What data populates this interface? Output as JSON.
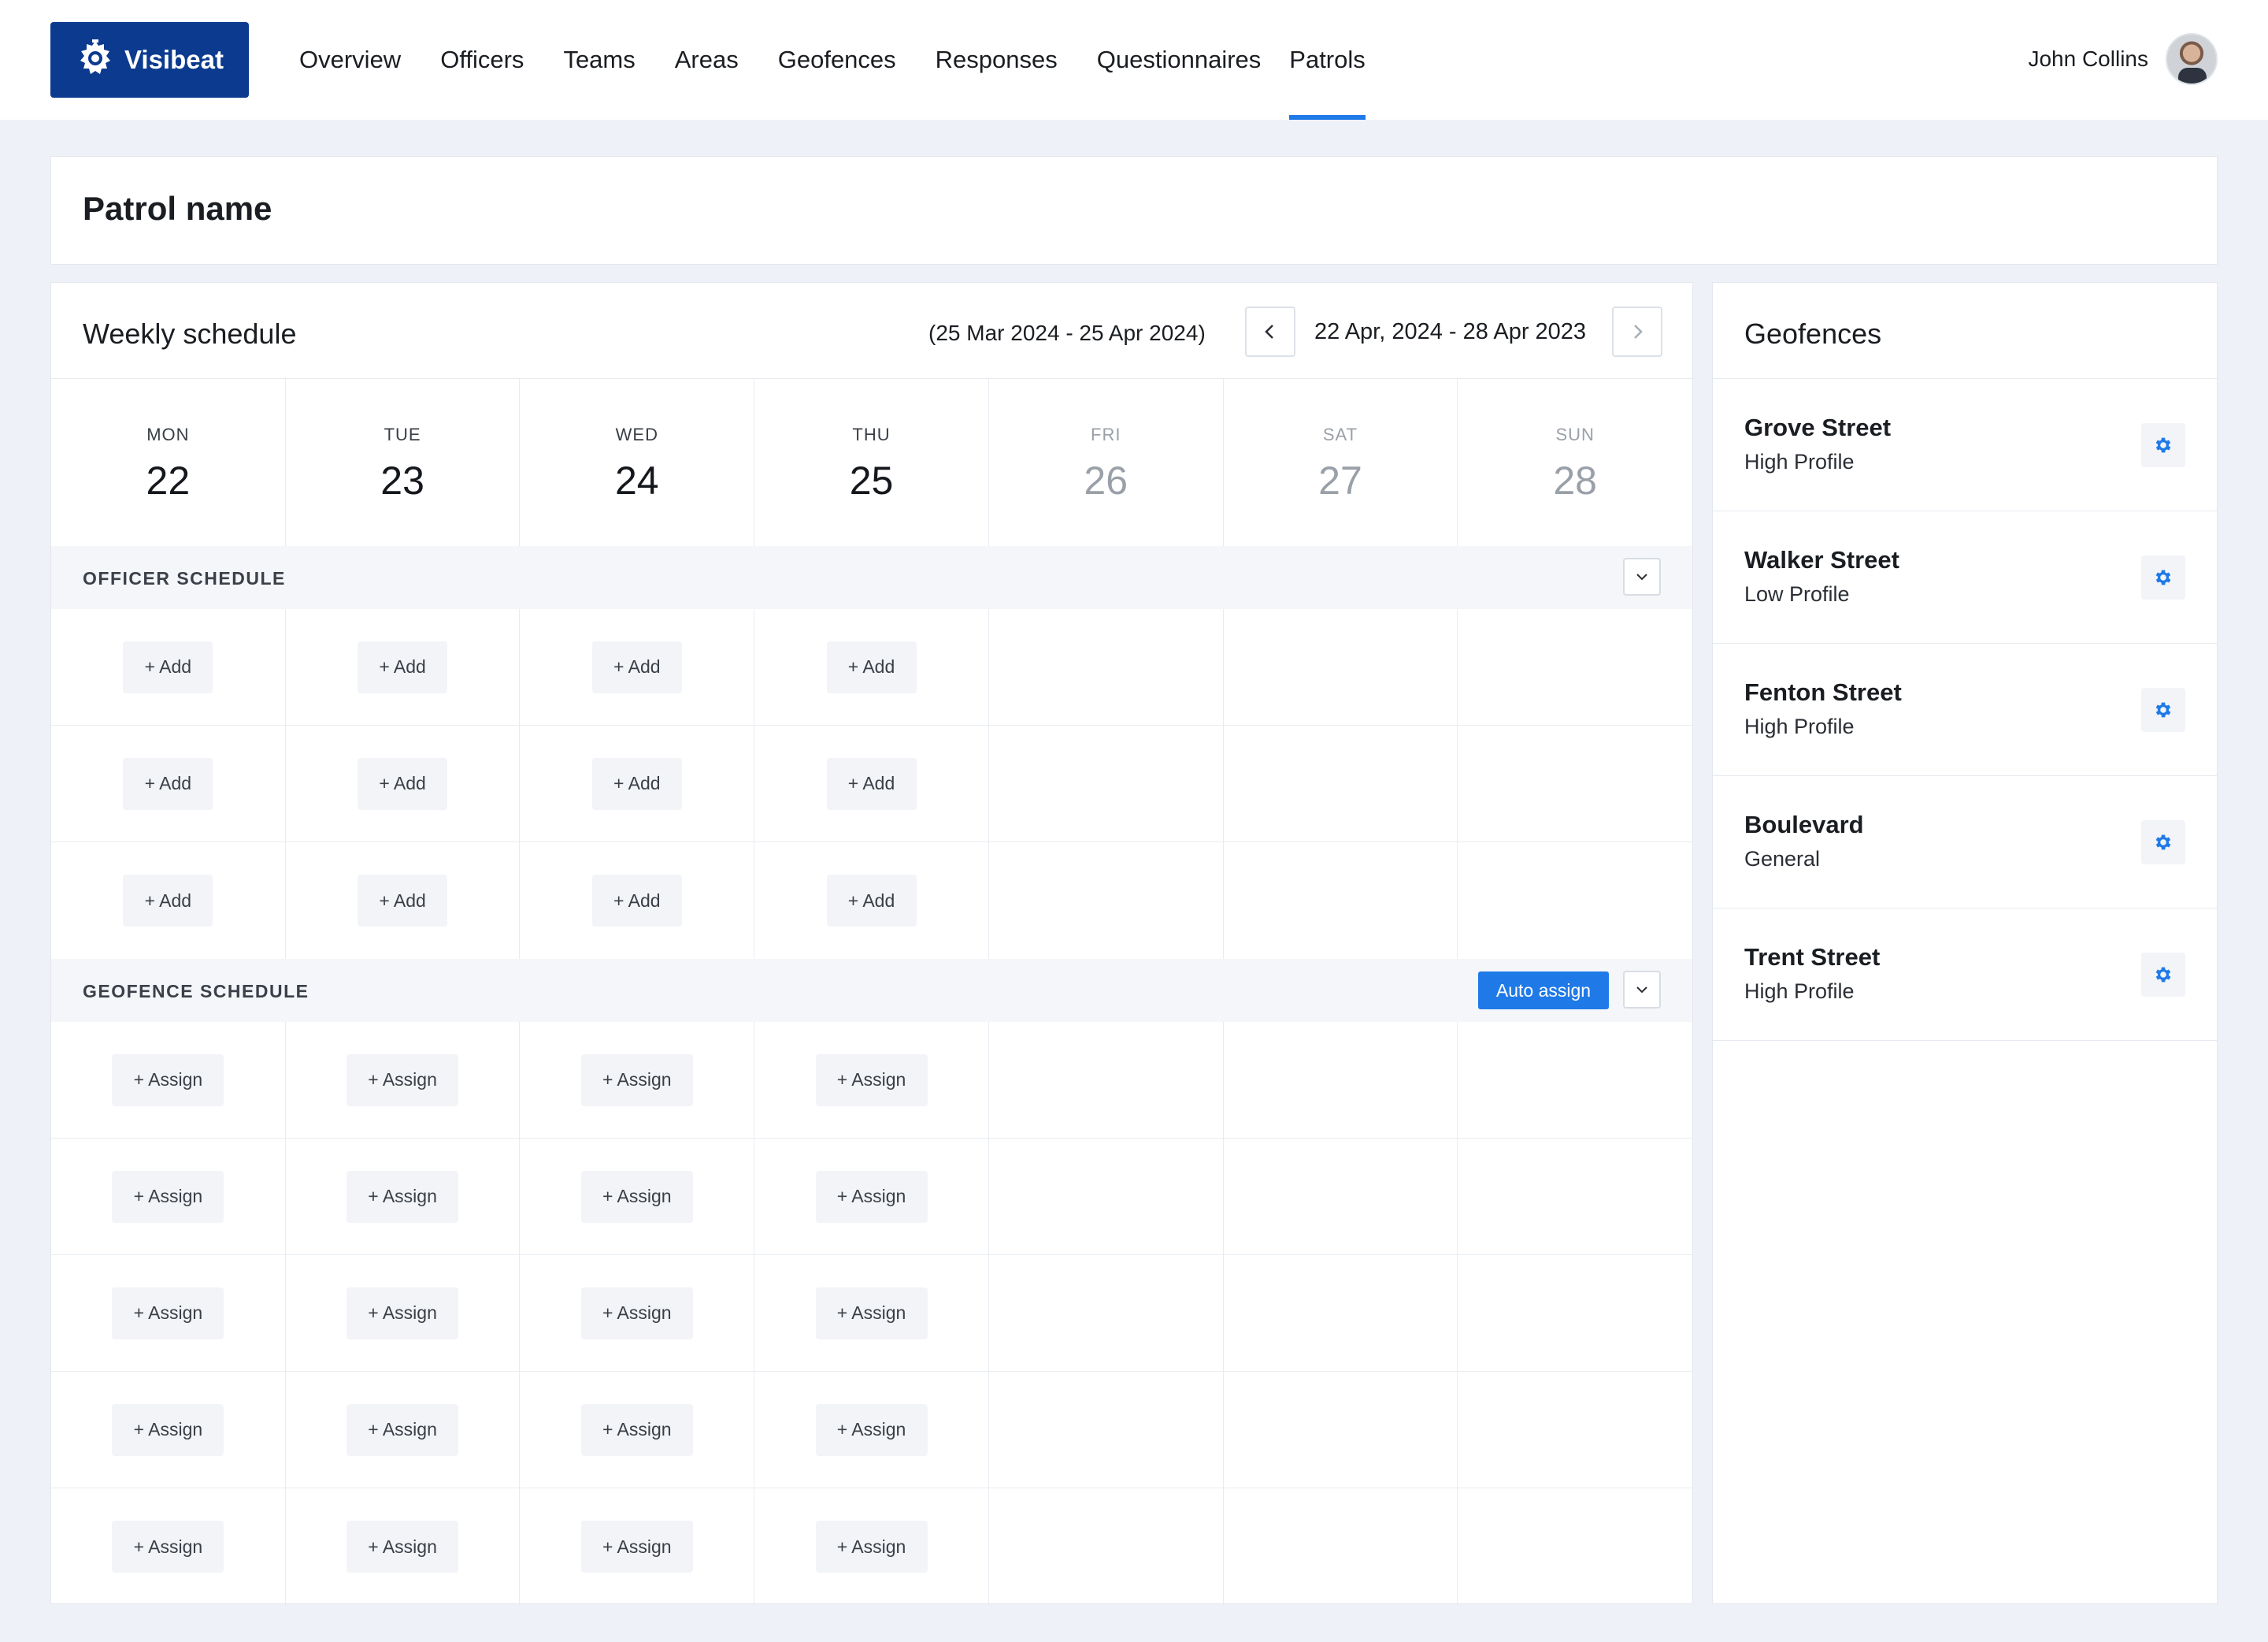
{
  "app": {
    "name": "Visibeat"
  },
  "nav": {
    "items": [
      {
        "label": "Overview"
      },
      {
        "label": "Officers"
      },
      {
        "label": "Teams"
      },
      {
        "label": "Areas"
      },
      {
        "label": "Geofences"
      },
      {
        "label": "Responses"
      },
      {
        "label": "Questionnaires"
      },
      {
        "label": "Patrols",
        "active": true
      }
    ]
  },
  "user": {
    "name": "John Collins"
  },
  "page": {
    "title": "Patrol name"
  },
  "schedule": {
    "title": "Weekly schedule",
    "overall_range": "(25 Mar 2024 - 25 Apr 2024)",
    "week_range": "22 Apr, 2024 -  28 Apr 2023",
    "days": [
      {
        "name": "MON",
        "num": "22",
        "muted": false
      },
      {
        "name": "TUE",
        "num": "23",
        "muted": false
      },
      {
        "name": "WED",
        "num": "24",
        "muted": false
      },
      {
        "name": "THU",
        "num": "25",
        "muted": false
      },
      {
        "name": "FRI",
        "num": "26",
        "muted": true
      },
      {
        "name": "SAT",
        "num": "27",
        "muted": true
      },
      {
        "name": "SUN",
        "num": "28",
        "muted": true
      }
    ],
    "officer_section": {
      "label": "OFFICER SCHEDULE",
      "add_label": "+ Add",
      "rows": 3,
      "active_days": 4
    },
    "geofence_section": {
      "label": "GEOFENCE SCHEDULE",
      "auto_assign_label": "Auto assign",
      "assign_label": "+ Assign",
      "rows": 5,
      "active_days": 4
    }
  },
  "geofences": {
    "title": "Geofences",
    "items": [
      {
        "name": "Grove Street",
        "profile": "High Profile"
      },
      {
        "name": "Walker Street",
        "profile": "Low Profile"
      },
      {
        "name": "Fenton Street",
        "profile": "High Profile"
      },
      {
        "name": "Boulevard",
        "profile": "General"
      },
      {
        "name": "Trent Street",
        "profile": "High Profile"
      }
    ]
  },
  "colors": {
    "brand": "#0b3a8f",
    "accent": "#1f7ae8",
    "background": "#eef1f7"
  },
  "icons": {
    "logo": "police-badge-icon",
    "prev": "chevron-left-icon",
    "next": "chevron-right-icon",
    "collapse": "chevron-down-icon",
    "settings": "gear-icon"
  }
}
